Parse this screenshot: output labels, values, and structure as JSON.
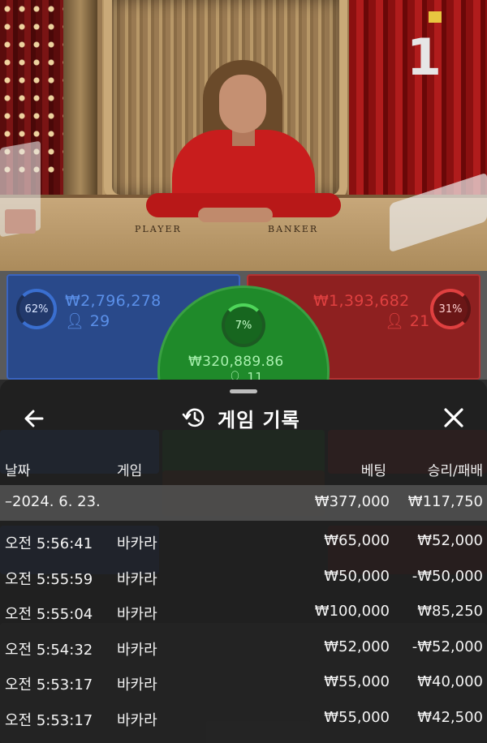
{
  "video": {
    "round_number": "1",
    "table_labels": {
      "player": "PLAYER",
      "banker": "BANKER"
    }
  },
  "bets": {
    "player": {
      "percent": "62%",
      "amount": "₩2,796,278",
      "players": "29"
    },
    "banker": {
      "percent": "31%",
      "amount": "₩1,393,682",
      "players": "21"
    },
    "tie": {
      "percent": "7%",
      "amount": "₩320,889.86",
      "players": "11"
    }
  },
  "history": {
    "title": "게임 기록",
    "columns": {
      "date": "날짜",
      "game": "게임",
      "bet": "베팅",
      "win_loss": "승리/패배"
    },
    "summary": {
      "date": "–2024. 6. 23.",
      "bet": "₩377,000",
      "win_loss": "₩117,750"
    },
    "rows": [
      {
        "time": "오전 5:56:41",
        "game": "바카라",
        "bet": "₩65,000",
        "win_loss": "₩52,000"
      },
      {
        "time": "오전 5:55:59",
        "game": "바카라",
        "bet": "₩50,000",
        "win_loss": "-₩50,000"
      },
      {
        "time": "오전 5:55:04",
        "game": "바카라",
        "bet": "₩100,000",
        "win_loss": "₩85,250"
      },
      {
        "time": "오전 5:54:32",
        "game": "바카라",
        "bet": "₩52,000",
        "win_loss": "-₩52,000"
      },
      {
        "time": "오전 5:53:17",
        "game": "바카라",
        "bet": "₩55,000",
        "win_loss": "₩40,000"
      },
      {
        "time": "오전 5:53:17",
        "game": "바카라",
        "bet": "₩55,000",
        "win_loss": "₩42,500"
      }
    ]
  },
  "colors": {
    "player": "#2f5fc4",
    "banker": "#c03030",
    "tie": "#1f8a2a",
    "sheet_bg": "#1e1e1e"
  },
  "icons": {
    "back": "arrow-left-icon",
    "close": "close-icon",
    "history": "history-icon",
    "person": "person-icon"
  }
}
